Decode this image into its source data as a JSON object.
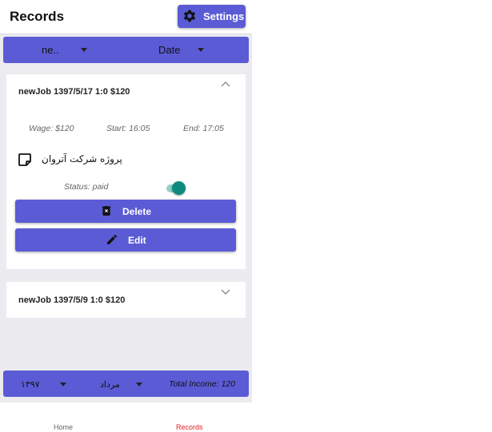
{
  "header": {
    "title": "Records",
    "settings_label": "Settings",
    "settings_icon": "gear-icon"
  },
  "filters": {
    "job_value": "ne..",
    "sort_value": "Date"
  },
  "records": [
    {
      "title": "newJob 1397/5/17 1:0 $120",
      "expanded": true,
      "wage": "Wage: $120",
      "start": "Start: 16:05",
      "end": "End: 17:05",
      "note": "پروژه شرکت آتروان",
      "status": "Status: paid",
      "paid": true,
      "delete_label": "Delete",
      "edit_label": "Edit"
    },
    {
      "title": "newJob 1397/5/9 1:0 $120",
      "expanded": false
    }
  ],
  "footer": {
    "year": "۱۳۹۷",
    "month": "مرداد",
    "total_income": "Total Income: 120"
  },
  "tabs": [
    {
      "label": "Home",
      "active": false
    },
    {
      "label": "Records",
      "active": true
    }
  ],
  "colors": {
    "primary": "#5b5bd6",
    "accent": "#0f8a7e",
    "active_tab": "#e02020",
    "background": "#ebebf0"
  }
}
